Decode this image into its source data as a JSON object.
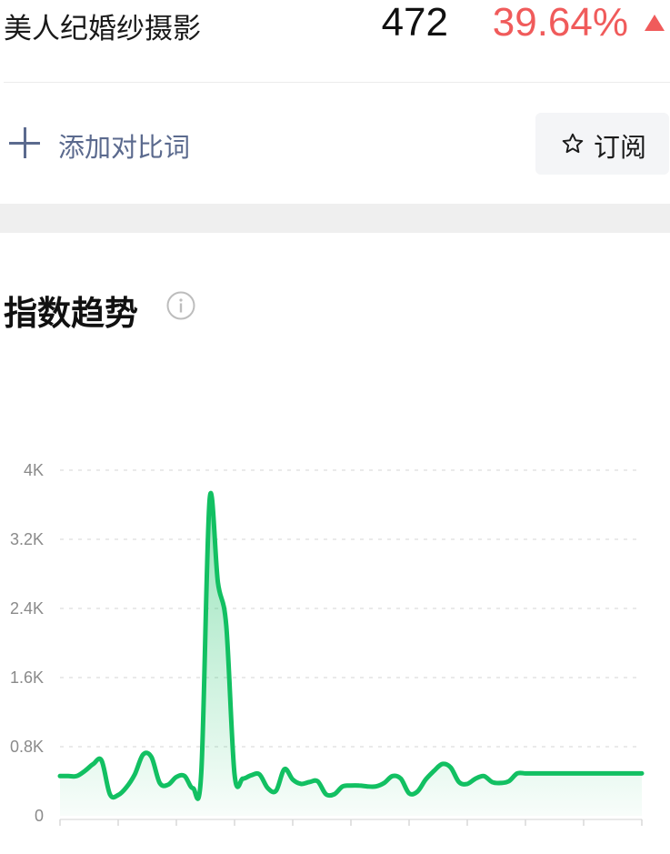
{
  "header": {
    "keyword": "美人纪婚纱摄影",
    "count": "472",
    "change": "39.64%",
    "trend_icon": "triangle-up-icon",
    "up_color": "#f05b5b"
  },
  "compare": {
    "add_label": "添加对比词",
    "subscribe_label": "订阅"
  },
  "section": {
    "title": "指数趋势"
  },
  "chart_data": {
    "type": "area",
    "title": "",
    "xlabel": "",
    "ylabel": "",
    "ylim": [
      0,
      4000
    ],
    "yticks": [
      0,
      800,
      1600,
      2400,
      3200,
      4000
    ],
    "ytick_labels": [
      "0",
      "0.8K",
      "1.6K",
      "2.4K",
      "3.2K",
      "4K"
    ],
    "grid": true,
    "line_color": "#12c062",
    "x": [
      0,
      1,
      2,
      3,
      4,
      5,
      6,
      7,
      8,
      9,
      10,
      11,
      12,
      13,
      14,
      15,
      16,
      17,
      18,
      19,
      20,
      21,
      22,
      23,
      24,
      25,
      26,
      27,
      28,
      29,
      30,
      31,
      32,
      33,
      34,
      35,
      36,
      37,
      38,
      39,
      40,
      41,
      42,
      43,
      44,
      45,
      46,
      47,
      48,
      49,
      50,
      51,
      52,
      53,
      54,
      55,
      56,
      57,
      58,
      59,
      60,
      61,
      62,
      63,
      64,
      65,
      66,
      67,
      68,
      69,
      70
    ],
    "values": [
      460,
      460,
      460,
      520,
      600,
      640,
      250,
      240,
      330,
      480,
      710,
      680,
      380,
      360,
      450,
      460,
      320,
      500,
      3660,
      2700,
      2200,
      480,
      430,
      470,
      480,
      320,
      290,
      540,
      420,
      370,
      390,
      400,
      250,
      250,
      340,
      350,
      350,
      340,
      340,
      380,
      460,
      430,
      260,
      280,
      420,
      520,
      600,
      560,
      390,
      370,
      430,
      460,
      390,
      380,
      400,
      490,
      490,
      490,
      490,
      490,
      490,
      490,
      490,
      490,
      490,
      490,
      490,
      490,
      490,
      490,
      490
    ]
  }
}
